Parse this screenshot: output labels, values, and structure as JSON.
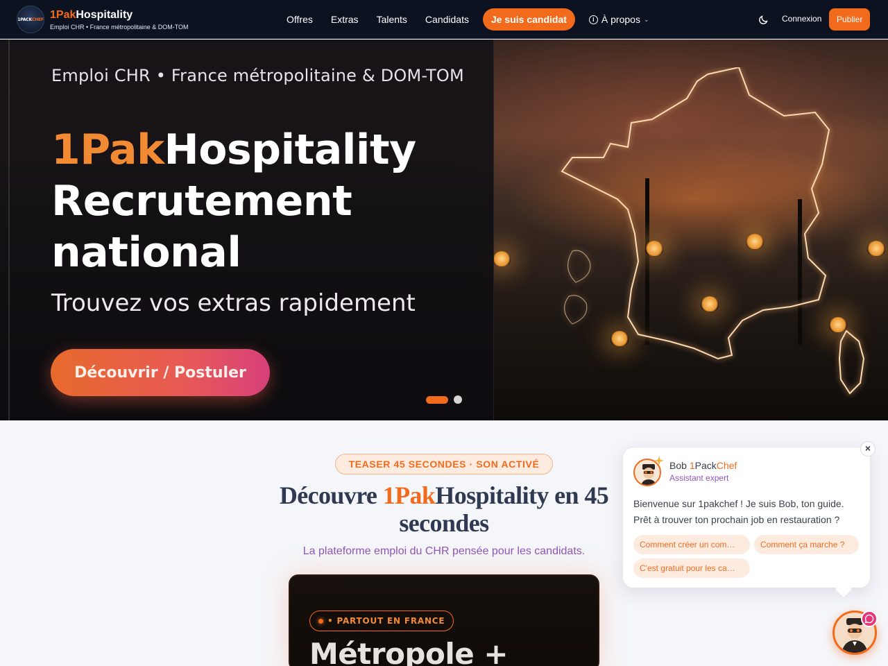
{
  "nav": {
    "logo_text_a": "1PACK",
    "logo_text_b": "CHEF",
    "brand_a": "1Pak",
    "brand_b": "Hospitality",
    "brand_sub": "Emploi CHR • France métropolitaine & DOM-TOM",
    "links": [
      "Offres",
      "Extras",
      "Talents",
      "Candidats"
    ],
    "cta": "Je suis candidat",
    "about": "À propos",
    "login": "Connexion",
    "publish": "Publier"
  },
  "hero": {
    "eyebrow": "Emploi CHR • France métropolitaine & DOM-TOM",
    "title_a": "1Pak",
    "title_b": "Hospitality",
    "title_line2": "Recrutement",
    "title_line3": "national",
    "tagline": "Trouvez vos extras rapidement",
    "button": "Découvrir / Postuler",
    "slides_total": 2,
    "slide_active": 1
  },
  "section": {
    "badge": " TEASER 45 SECONDES · SON ACTIVÉ",
    "title_a": "Découvre ",
    "title_b": "1Pak",
    "title_c": "Hospitality en 45 secondes",
    "subtitle": "La plateforme emploi du CHR pensée pour les candidats.",
    "video_pill": "• PARTOUT EN FRANCE",
    "video_title": "Métropole +"
  },
  "chat": {
    "name_a": "Bob ",
    "name_b": "1",
    "name_c": "Pack",
    "name_d": "Chef",
    "role": "Assistant expert",
    "message": " Bienvenue sur 1pakchef ! Je suis Bob, ton guide. Prêt à trouver ton prochain job en restauration ?",
    "chips": [
      " Comment créer un com…",
      " Comment ça marche ?",
      " C'est gratuit pour les ca…"
    ],
    "close": "×"
  },
  "colors": {
    "accent": "#f26b1d",
    "nav_bg": "#0c1220",
    "purple": "#8d56b8"
  }
}
